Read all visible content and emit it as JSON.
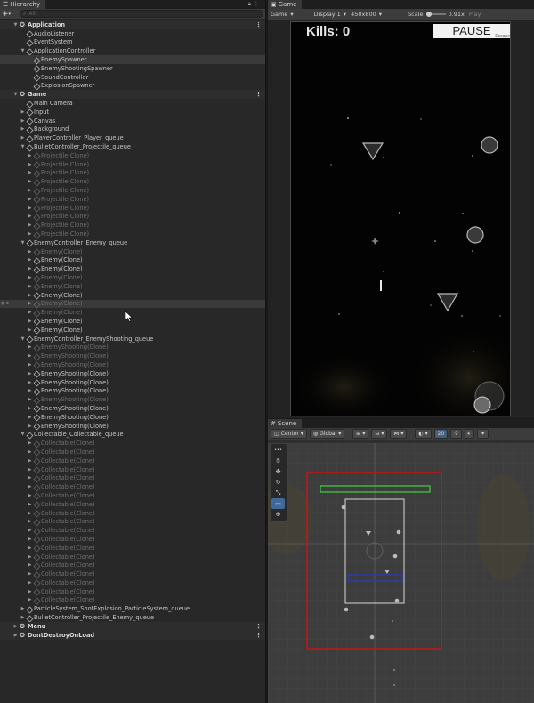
{
  "hierarchy": {
    "tab_label": "Hierarchy",
    "search_placeholder": "All",
    "rows": [
      {
        "label": "Application",
        "depth": 0,
        "type": "scene",
        "arrow": "down",
        "menu": true
      },
      {
        "label": "AudioListener",
        "depth": 1,
        "type": "obj"
      },
      {
        "label": "EventSystem",
        "depth": 1,
        "type": "obj"
      },
      {
        "label": "ApplicationController",
        "depth": 1,
        "type": "obj",
        "arrow": "down"
      },
      {
        "label": "EnemySpawner",
        "depth": 2,
        "type": "obj",
        "selected": true
      },
      {
        "label": "EnemyShootingSpawner",
        "depth": 2,
        "type": "obj"
      },
      {
        "label": "SoundController",
        "depth": 2,
        "type": "obj"
      },
      {
        "label": "ExplosionSpawner",
        "depth": 2,
        "type": "obj"
      },
      {
        "label": "Game",
        "depth": 0,
        "type": "scene",
        "arrow": "down",
        "menu": true
      },
      {
        "label": "Main Camera",
        "depth": 1,
        "type": "obj"
      },
      {
        "label": "Input",
        "depth": 1,
        "type": "obj",
        "arrow": "right"
      },
      {
        "label": "Canvas",
        "depth": 1,
        "type": "obj",
        "arrow": "right"
      },
      {
        "label": "Background",
        "depth": 1,
        "type": "obj",
        "arrow": "right"
      },
      {
        "label": "PlayerController_Player_queue",
        "depth": 1,
        "type": "obj",
        "arrow": "right"
      },
      {
        "label": "BulletController_Projectile_queue",
        "depth": 1,
        "type": "obj",
        "arrow": "down"
      },
      {
        "label": "Projectile(Clone)",
        "depth": 2,
        "type": "obj",
        "arrow": "right",
        "dim": true
      },
      {
        "label": "Projectile(Clone)",
        "depth": 2,
        "type": "obj",
        "arrow": "right",
        "dim": true
      },
      {
        "label": "Projectile(Clone)",
        "depth": 2,
        "type": "obj",
        "arrow": "right",
        "dim": true
      },
      {
        "label": "Projectile(Clone)",
        "depth": 2,
        "type": "obj",
        "arrow": "right",
        "dim": true
      },
      {
        "label": "Projectile(Clone)",
        "depth": 2,
        "type": "obj",
        "arrow": "right",
        "dim": true
      },
      {
        "label": "Projectile(Clone)",
        "depth": 2,
        "type": "obj",
        "arrow": "right",
        "dim": true
      },
      {
        "label": "Projectile(Clone)",
        "depth": 2,
        "type": "obj",
        "arrow": "right",
        "dim": true
      },
      {
        "label": "Projectile(Clone)",
        "depth": 2,
        "type": "obj",
        "arrow": "right",
        "dim": true
      },
      {
        "label": "Projectile(Clone)",
        "depth": 2,
        "type": "obj",
        "arrow": "right",
        "dim": true
      },
      {
        "label": "Projectile(Clone)",
        "depth": 2,
        "type": "obj",
        "arrow": "right",
        "dim": true
      },
      {
        "label": "EnemyController_Enemy_queue",
        "depth": 1,
        "type": "obj",
        "arrow": "down"
      },
      {
        "label": "Enemy(Clone)",
        "depth": 2,
        "type": "obj",
        "arrow": "right",
        "dim": true
      },
      {
        "label": "Enemy(Clone)",
        "depth": 2,
        "type": "obj",
        "arrow": "right"
      },
      {
        "label": "Enemy(Clone)",
        "depth": 2,
        "type": "obj",
        "arrow": "right"
      },
      {
        "label": "Enemy(Clone)",
        "depth": 2,
        "type": "obj",
        "arrow": "right",
        "dim": true
      },
      {
        "label": "Enemy(Clone)",
        "depth": 2,
        "type": "obj",
        "arrow": "right",
        "dim": true
      },
      {
        "label": "Enemy(Clone)",
        "depth": 2,
        "type": "obj",
        "arrow": "right"
      },
      {
        "label": "Enemy(Clone)",
        "depth": 2,
        "type": "obj",
        "arrow": "right",
        "dim": true,
        "hover": true
      },
      {
        "label": "Enemy(Clone)",
        "depth": 2,
        "type": "obj",
        "arrow": "right",
        "dim": true
      },
      {
        "label": "Enemy(Clone)",
        "depth": 2,
        "type": "obj",
        "arrow": "right"
      },
      {
        "label": "Enemy(Clone)",
        "depth": 2,
        "type": "obj",
        "arrow": "right"
      },
      {
        "label": "EnemyController_EnemyShooting_queue",
        "depth": 1,
        "type": "obj",
        "arrow": "down"
      },
      {
        "label": "EnemyShooting(Clone)",
        "depth": 2,
        "type": "obj",
        "arrow": "right",
        "dim": true
      },
      {
        "label": "EnemyShooting(Clone)",
        "depth": 2,
        "type": "obj",
        "arrow": "right",
        "dim": true
      },
      {
        "label": "EnemyShooting(Clone)",
        "depth": 2,
        "type": "obj",
        "arrow": "right",
        "dim": true
      },
      {
        "label": "EnemyShooting(Clone)",
        "depth": 2,
        "type": "obj",
        "arrow": "right"
      },
      {
        "label": "EnemyShooting(Clone)",
        "depth": 2,
        "type": "obj",
        "arrow": "right"
      },
      {
        "label": "EnemyShooting(Clone)",
        "depth": 2,
        "type": "obj",
        "arrow": "right"
      },
      {
        "label": "EnemyShooting(Clone)",
        "depth": 2,
        "type": "obj",
        "arrow": "right",
        "dim": true
      },
      {
        "label": "EnemyShooting(Clone)",
        "depth": 2,
        "type": "obj",
        "arrow": "right"
      },
      {
        "label": "EnemyShooting(Clone)",
        "depth": 2,
        "type": "obj",
        "arrow": "right"
      },
      {
        "label": "EnemyShooting(Clone)",
        "depth": 2,
        "type": "obj",
        "arrow": "right"
      },
      {
        "label": "Collectable_Collectable_queue",
        "depth": 1,
        "type": "obj",
        "arrow": "down"
      },
      {
        "label": "Collectable(Clone)",
        "depth": 2,
        "type": "obj",
        "arrow": "right",
        "dim": true
      },
      {
        "label": "Collectable(Clone)",
        "depth": 2,
        "type": "obj",
        "arrow": "right",
        "dim": true
      },
      {
        "label": "Collectable(Clone)",
        "depth": 2,
        "type": "obj",
        "arrow": "right",
        "dim": true
      },
      {
        "label": "Collectable(Clone)",
        "depth": 2,
        "type": "obj",
        "arrow": "right",
        "dim": true
      },
      {
        "label": "Collectable(Clone)",
        "depth": 2,
        "type": "obj",
        "arrow": "right",
        "dim": true
      },
      {
        "label": "Collectable(Clone)",
        "depth": 2,
        "type": "obj",
        "arrow": "right",
        "dim": true
      },
      {
        "label": "Collectable(Clone)",
        "depth": 2,
        "type": "obj",
        "arrow": "right",
        "dim": true
      },
      {
        "label": "Collectable(Clone)",
        "depth": 2,
        "type": "obj",
        "arrow": "right",
        "dim": true
      },
      {
        "label": "Collectable(Clone)",
        "depth": 2,
        "type": "obj",
        "arrow": "right",
        "dim": true
      },
      {
        "label": "Collectable(Clone)",
        "depth": 2,
        "type": "obj",
        "arrow": "right",
        "dim": true
      },
      {
        "label": "Collectable(Clone)",
        "depth": 2,
        "type": "obj",
        "arrow": "right",
        "dim": true
      },
      {
        "label": "Collectable(Clone)",
        "depth": 2,
        "type": "obj",
        "arrow": "right",
        "dim": true
      },
      {
        "label": "Collectable(Clone)",
        "depth": 2,
        "type": "obj",
        "arrow": "right",
        "dim": true
      },
      {
        "label": "Collectable(Clone)",
        "depth": 2,
        "type": "obj",
        "arrow": "right",
        "dim": true
      },
      {
        "label": "Collectable(Clone)",
        "depth": 2,
        "type": "obj",
        "arrow": "right",
        "dim": true
      },
      {
        "label": "Collectable(Clone)",
        "depth": 2,
        "type": "obj",
        "arrow": "right",
        "dim": true
      },
      {
        "label": "Collectable(Clone)",
        "depth": 2,
        "type": "obj",
        "arrow": "right",
        "dim": true
      },
      {
        "label": "Collectable(Clone)",
        "depth": 2,
        "type": "obj",
        "arrow": "right",
        "dim": true
      },
      {
        "label": "Collectable(Clone)",
        "depth": 2,
        "type": "obj",
        "arrow": "right",
        "dim": true
      },
      {
        "label": "ParticleSystem_ShotExplosion_ParticleSystem_queue",
        "depth": 1,
        "type": "obj",
        "arrow": "right"
      },
      {
        "label": "BulletController_Projectile_Enemy_queue",
        "depth": 1,
        "type": "obj",
        "arrow": "right"
      },
      {
        "label": "Menu",
        "depth": 0,
        "type": "scene",
        "arrow": "right",
        "menu": true
      },
      {
        "label": "DontDestroyOnLoad",
        "depth": 0,
        "type": "scene",
        "arrow": "right",
        "menu": true
      }
    ]
  },
  "game": {
    "tab_label": "Game",
    "mode": "Game",
    "display": "Display 1",
    "resolution": "450x800",
    "scale_label": "Scale",
    "scale_value": "0.91x",
    "play_label": "Play",
    "kills_text": "Kills: 0",
    "pause_label": "PAUSE",
    "pause_sub": "Escape"
  },
  "scene": {
    "tab_label": "Scene",
    "pivot": "Center",
    "space": "Global",
    "mode_2d": "2D",
    "gizmo_count": "20"
  },
  "colors": {
    "selection": "#3a3a3a",
    "accent": "#3d6a9a",
    "camera_frame": "#c0181a",
    "green_rect": "#3fd23f",
    "blue_rect": "#2838c8"
  }
}
